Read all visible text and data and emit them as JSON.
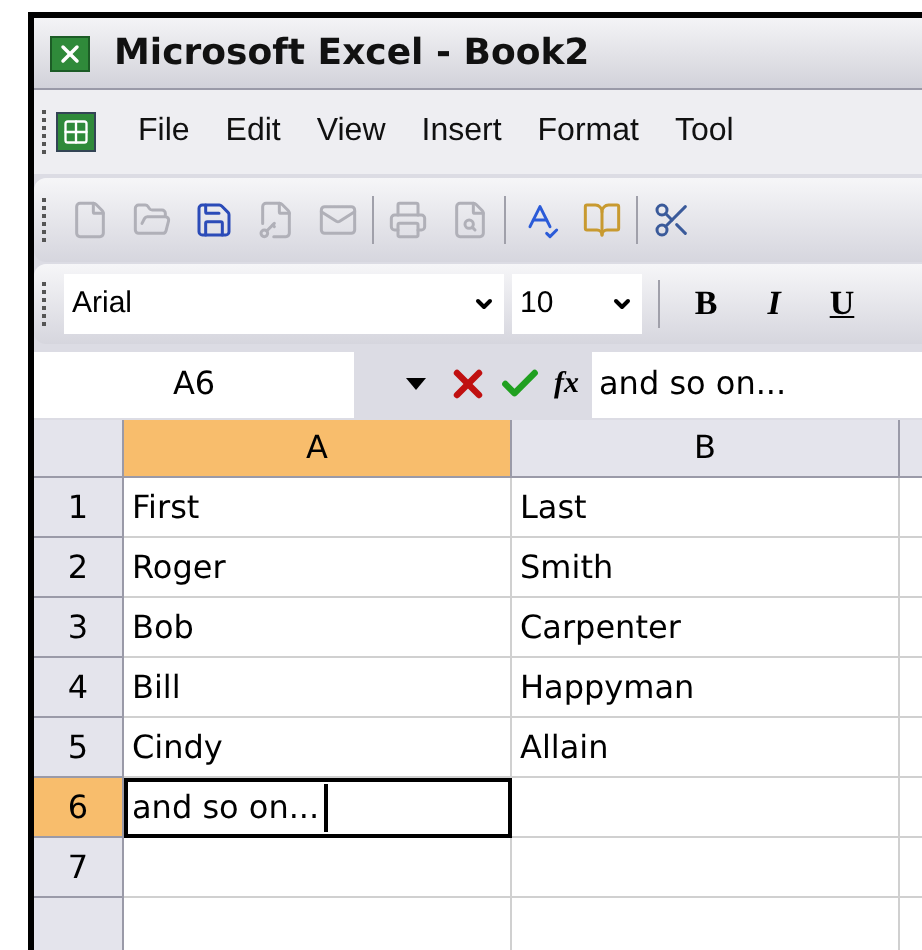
{
  "window": {
    "title": "Microsoft Excel - Book2"
  },
  "menu": [
    "File",
    "Edit",
    "View",
    "Insert",
    "Format",
    "Tool"
  ],
  "format_toolbar": {
    "font": "Arial",
    "size": "10",
    "buttons": [
      {
        "kind": "bold",
        "label": "B"
      },
      {
        "kind": "italic",
        "label": "I"
      },
      {
        "kind": "underline",
        "label": "U"
      }
    ]
  },
  "formula_bar": {
    "name_box": "A6",
    "function_label": "fx",
    "content": "and so on..."
  },
  "columns": [
    {
      "label": "A",
      "selected": true
    },
    {
      "label": "B",
      "selected": false
    }
  ],
  "rows": [
    {
      "number": "1",
      "selected": false,
      "cells": [
        "First",
        "Last"
      ]
    },
    {
      "number": "2",
      "selected": false,
      "cells": [
        "Roger",
        "Smith"
      ]
    },
    {
      "number": "3",
      "selected": false,
      "cells": [
        "Bob",
        "Carpenter"
      ]
    },
    {
      "number": "4",
      "selected": false,
      "cells": [
        "Bill",
        "Happyman"
      ]
    },
    {
      "number": "5",
      "selected": false,
      "cells": [
        "Cindy",
        "Allain"
      ]
    },
    {
      "number": "6",
      "selected": true,
      "cells": [
        "and so on...",
        ""
      ]
    },
    {
      "number": "7",
      "selected": false,
      "cells": [
        "",
        ""
      ]
    }
  ]
}
